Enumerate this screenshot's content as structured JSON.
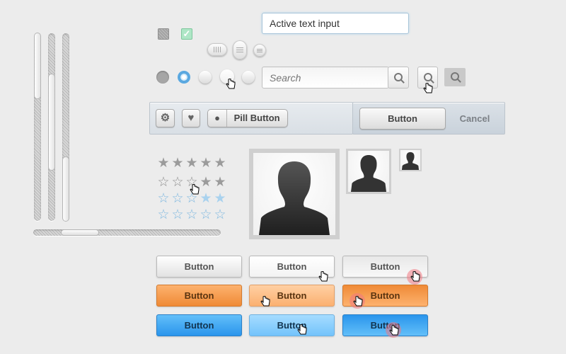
{
  "text_input": {
    "value": "Active text input"
  },
  "search": {
    "placeholder": "Search"
  },
  "toolbar": {
    "pill_button_label": "Pill Button",
    "button_label": "Button",
    "cancel_label": "Cancel"
  },
  "icons": {
    "gear": "gear-icon",
    "heart": "heart-icon",
    "apple": "apple-icon",
    "search": "search-icon"
  },
  "ratings": [
    {
      "filled": 5,
      "style": "gray-filled"
    },
    {
      "filled": 2,
      "style": "gray-mixed"
    },
    {
      "filled": 2,
      "style": "blue-mixed"
    },
    {
      "filled": 0,
      "style": "blue-outline"
    }
  ],
  "grid_buttons": {
    "rows": [
      {
        "color": "gray",
        "labels": [
          "Button",
          "Button",
          "Button"
        ]
      },
      {
        "color": "orange",
        "labels": [
          "Button",
          "Button",
          "Button"
        ]
      },
      {
        "color": "blue",
        "labels": [
          "Button",
          "Button",
          "Button"
        ]
      }
    ]
  },
  "sliders": {
    "vertical_values": [
      0.25,
      0.55,
      0.95
    ],
    "horizontal_value": 0.25
  },
  "colors": {
    "background": "#ececec",
    "accent_blue": "#2a95ec",
    "accent_orange": "#ef8a36",
    "checkbox_on": "#aee6c6",
    "radio_on": "#5aa8e0"
  }
}
